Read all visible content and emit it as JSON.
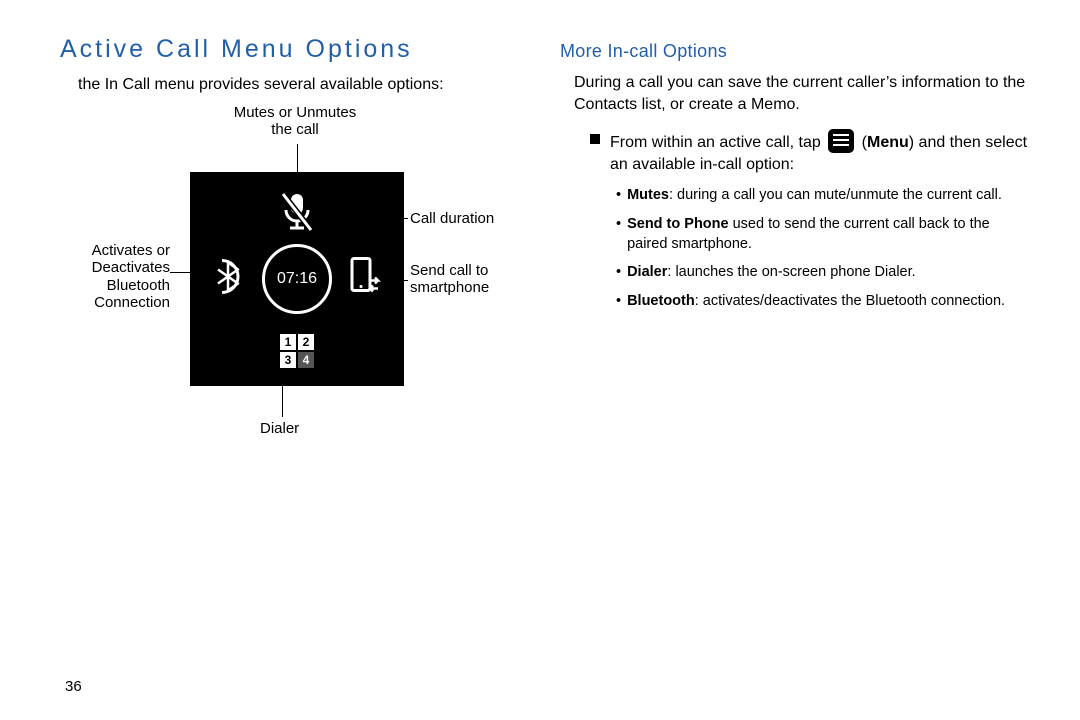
{
  "page_number": "36",
  "left": {
    "heading": "Active Call Menu Options",
    "intro": "the In Call menu provides several available options:",
    "annotations": {
      "mute": "Mutes or Unmutes\nthe call",
      "bluetooth": "Activates or\nDeactivates\nBluetooth\nConnection",
      "duration": "Call duration",
      "send": "Send call to\nsmartphone",
      "dialer": "Dialer"
    },
    "timer": "07:16"
  },
  "right": {
    "heading": "More In-call Options",
    "intro": "During a call you can save the current caller’s information to the Contacts list, or create a Memo.",
    "step_prefix": "From within an active call, tap ",
    "step_menu_word": "Menu",
    "step_suffix": ") and then select an available in-call option:",
    "options": [
      {
        "term": "Mutes",
        "desc": ": during a call you can mute/unmute the current call."
      },
      {
        "term": "Send to Phone",
        "desc": " used to send the current call back to the paired smartphone."
      },
      {
        "term": "Dialer",
        "desc": ": launches the on-screen phone Dialer."
      },
      {
        "term": "Bluetooth",
        "desc": ": activates/deactivates the Bluetooth connection."
      }
    ]
  }
}
